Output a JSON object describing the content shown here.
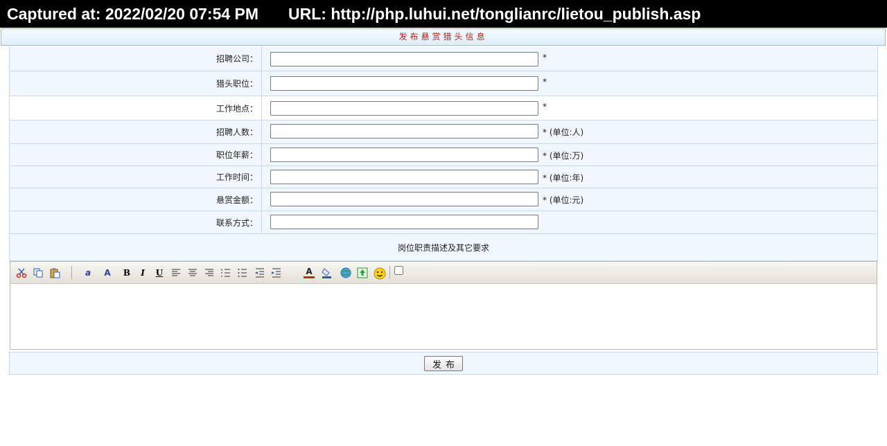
{
  "capture": {
    "captured_text": "Captured at: 2022/02/20 07:54 PM",
    "url_text": "URL: http://php.luhui.net/tonglianrc/lietou_publish.asp"
  },
  "form": {
    "title": "发布悬赏猎头信息",
    "fields": [
      {
        "label": "招聘公司：",
        "value": "",
        "note": "*"
      },
      {
        "label": "猎头职位：",
        "value": "",
        "note": "*"
      },
      {
        "label": "工作地点：",
        "value": "",
        "note": "*"
      },
      {
        "label": "招聘人数：",
        "value": "",
        "note": "* (单位:人)"
      },
      {
        "label": "职位年薪：",
        "value": "",
        "note": "* (单位:万)"
      },
      {
        "label": "工作时间：",
        "value": "",
        "note": "* (单位:年)"
      },
      {
        "label": "悬赏金额：",
        "value": "",
        "note": "* (单位:元)"
      },
      {
        "label": "联系方式：",
        "value": "",
        "note": ""
      }
    ],
    "description_label": "岗位职责描述及其它要求",
    "submit_label": "发布"
  },
  "toolbar": {
    "icons": [
      "cut-icon",
      "copy-icon",
      "paste-icon",
      "font-style-icon",
      "font-size-icon",
      "bold-icon",
      "italic-icon",
      "underline-icon",
      "align-left-icon",
      "align-center-icon",
      "align-right-icon",
      "ordered-list-icon",
      "unordered-list-icon",
      "outdent-icon",
      "indent-icon",
      "text-color-icon",
      "background-color-icon",
      "link-icon",
      "image-icon",
      "emoticon-icon"
    ],
    "bold": "B",
    "italic": "I",
    "underline": "U",
    "text_color": "A",
    "font_style": "a",
    "font_size": "A"
  }
}
